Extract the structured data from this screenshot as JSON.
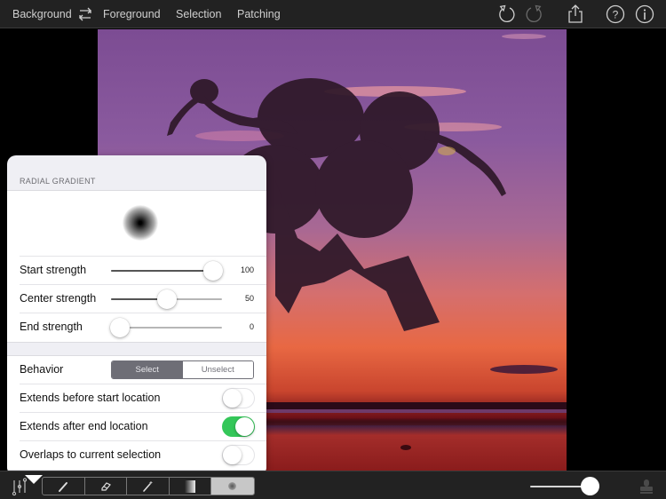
{
  "topbar": {
    "tabs": [
      {
        "label": "Background"
      },
      {
        "label": "Foreground"
      },
      {
        "label": "Selection"
      },
      {
        "label": "Patching"
      }
    ],
    "icons": [
      "swap-icon",
      "undo-icon",
      "redo-icon",
      "share-icon",
      "help-icon",
      "info-icon"
    ]
  },
  "canvas": {
    "image_description": "Olive tree silhouette cut out over purple-to-orange sunset sky above a red sea horizon"
  },
  "panel": {
    "title": "RADIAL GRADIENT",
    "sliders": [
      {
        "label": "Start strength",
        "value": "100",
        "fraction": 0.92
      },
      {
        "label": "Center strength",
        "value": "50",
        "fraction": 0.5
      },
      {
        "label": "End strength",
        "value": "0",
        "fraction": 0.08
      }
    ],
    "behavior": {
      "label": "Behavior",
      "options": [
        "Select",
        "Unselect"
      ],
      "selected": "Select"
    },
    "toggles": [
      {
        "label": "Extends before start location",
        "on": false
      },
      {
        "label": "Extends after end location",
        "on": true
      },
      {
        "label": "Overlaps to current selection",
        "on": false
      }
    ]
  },
  "bottombar": {
    "tools": [
      "brush-tool",
      "eraser-tool",
      "magic-wand-tool",
      "linear-gradient-tool",
      "radial-gradient-tool"
    ],
    "active_tool": "radial-gradient-tool",
    "brush_size_fraction": 0.9,
    "colors": {
      "active_segment": "#c7c7c7",
      "toggle_on": "#34c759",
      "bar": "#222222"
    }
  }
}
